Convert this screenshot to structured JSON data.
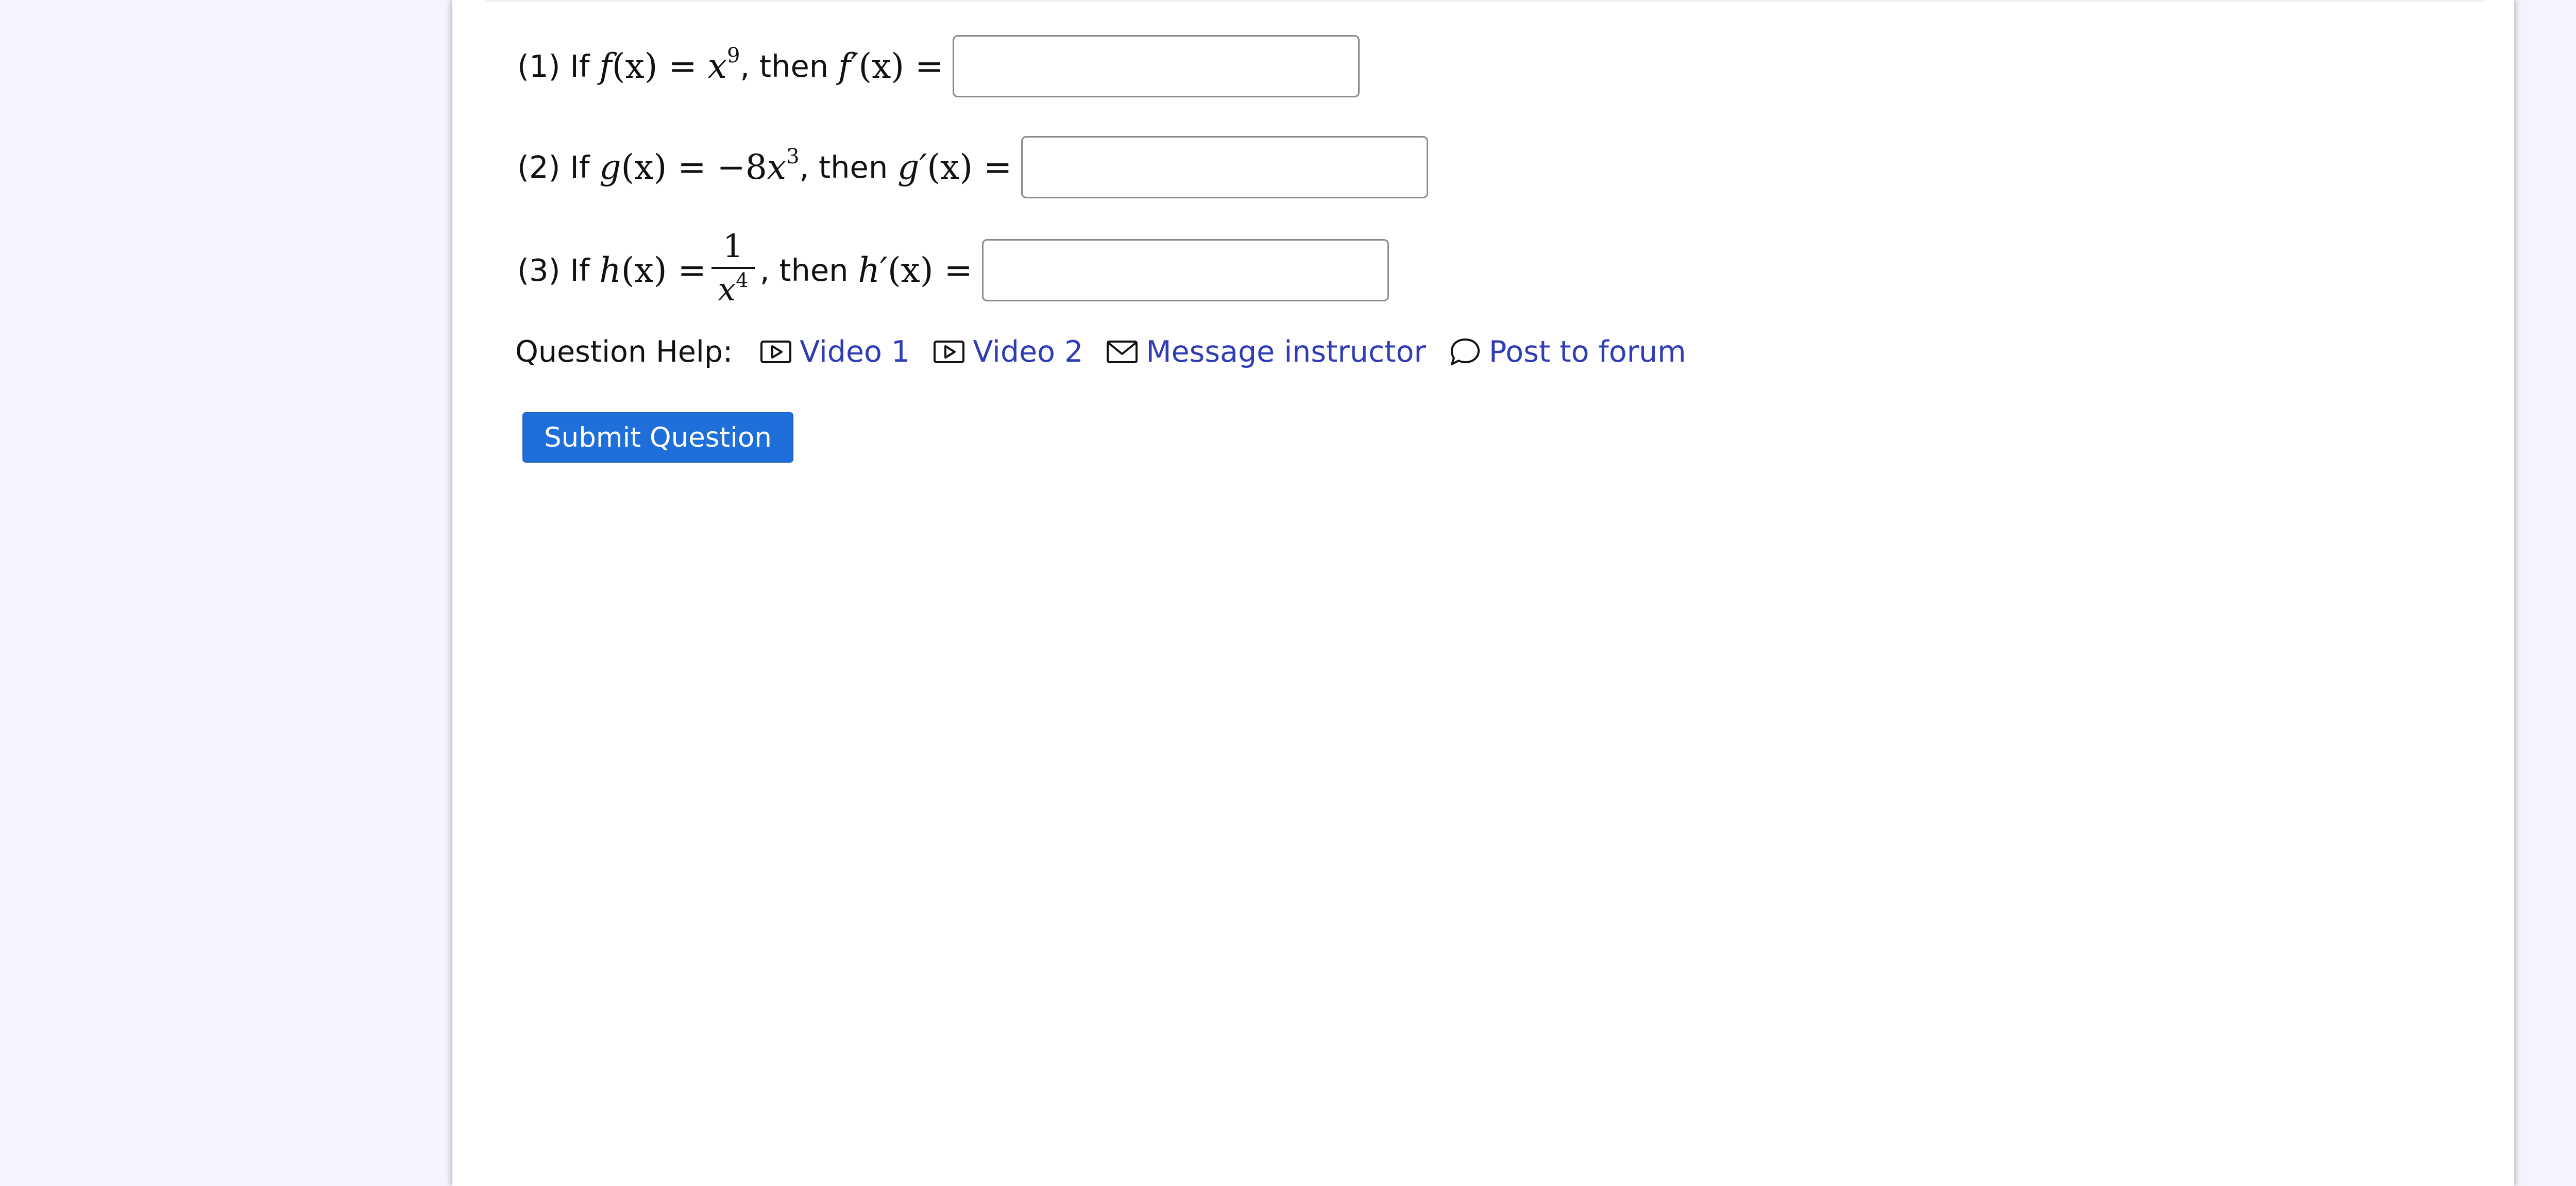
{
  "questions": [
    {
      "label": "(1) If",
      "fn": "f",
      "arg": "(x)",
      "eq": "=",
      "rhs_base": "x",
      "rhs_exp": "9",
      "then": ", then",
      "deriv": "f′",
      "deriv_arg": "(x)",
      "deriv_eq": "=",
      "answer": ""
    },
    {
      "label": "(2) If",
      "fn": "g",
      "arg": "(x)",
      "eq": "=",
      "rhs_coef": "−8",
      "rhs_base": "x",
      "rhs_exp": "3",
      "then": ", then",
      "deriv": "g′",
      "deriv_arg": "(x)",
      "deriv_eq": "=",
      "answer": ""
    },
    {
      "label": "(3) If",
      "fn": "h",
      "arg": "(x)",
      "eq": "=",
      "numerator": "1",
      "den_base": "x",
      "den_exp": "4",
      "then": ", then",
      "deriv": "h′",
      "deriv_arg": "(x)",
      "deriv_eq": "=",
      "answer": ""
    }
  ],
  "help": {
    "label": "Question Help:",
    "links": [
      {
        "label": "Video 1",
        "icon": "video-icon"
      },
      {
        "label": "Video 2",
        "icon": "video-icon"
      },
      {
        "label": "Message instructor",
        "icon": "envelope-icon"
      },
      {
        "label": "Post to forum",
        "icon": "speech-bubble-icon"
      }
    ]
  },
  "submit": {
    "label": "Submit Question"
  },
  "colors": {
    "link": "#2f3cb4",
    "button": "#1e6fd9",
    "background": "#f3f4fd"
  }
}
